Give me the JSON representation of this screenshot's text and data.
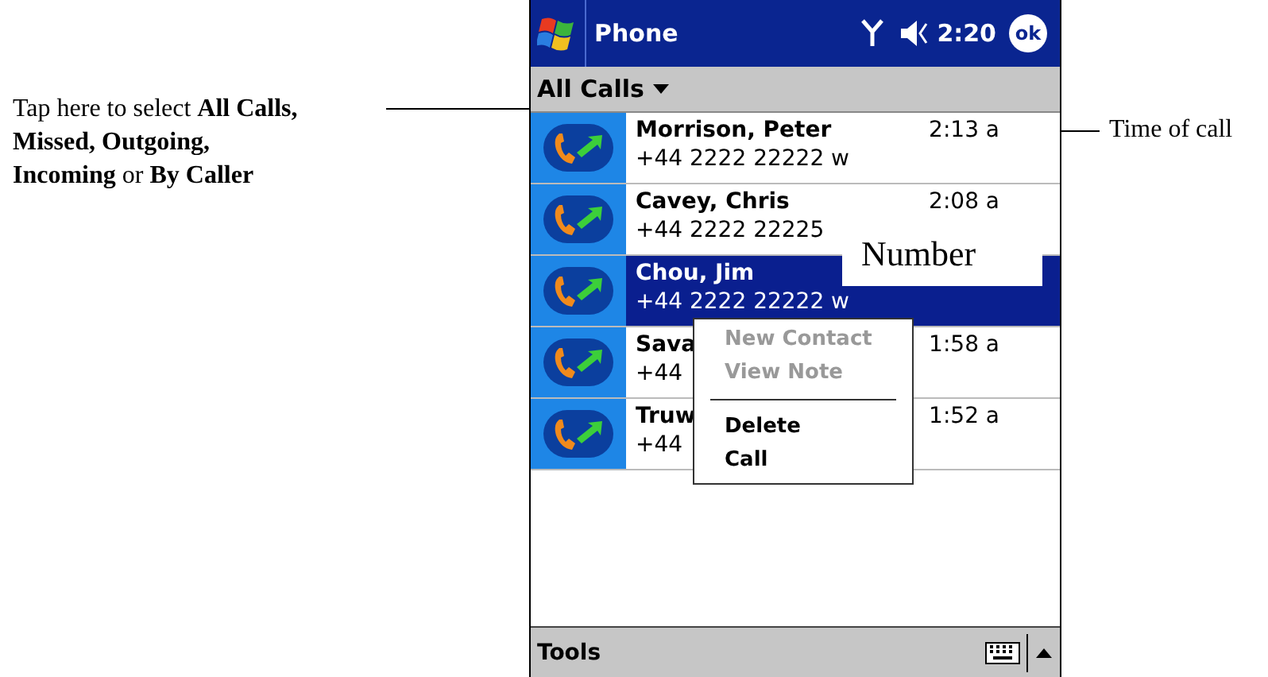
{
  "annotations": {
    "filter_hint": "Tap here to select **All Calls, Missed, Outgoing, Incoming** or **By Caller**",
    "time_label": "Time of call",
    "number_label": "Number"
  },
  "title_bar": {
    "title": "Phone",
    "time": "2:20",
    "ok": "ok"
  },
  "filter": {
    "label": "All Calls"
  },
  "calls": [
    {
      "name": "Morrison, Peter",
      "number": "+44 2222 22222 w",
      "time": "2:13 a",
      "selected": false
    },
    {
      "name": "Cavey, Chris",
      "number": "+44 2222 22225",
      "time": "2:08 a",
      "selected": false
    },
    {
      "name": "Chou, Jim",
      "number": "+44 2222 22222 w",
      "selected": true
    },
    {
      "name": "Sava",
      "number": "+44",
      "time": "1:58 a",
      "selected": false
    },
    {
      "name": "Truw",
      "number": "+44",
      "time": "1:52 a",
      "selected": false
    }
  ],
  "context_menu": [
    {
      "kind": "item",
      "label": "New Contact",
      "disabled": true
    },
    {
      "kind": "item",
      "label": "View Note",
      "disabled": true
    },
    {
      "kind": "separator"
    },
    {
      "kind": "item",
      "label": "Delete",
      "disabled": false
    },
    {
      "kind": "item",
      "label": "Call",
      "disabled": false
    }
  ],
  "menu_bar": {
    "tools": "Tools"
  }
}
